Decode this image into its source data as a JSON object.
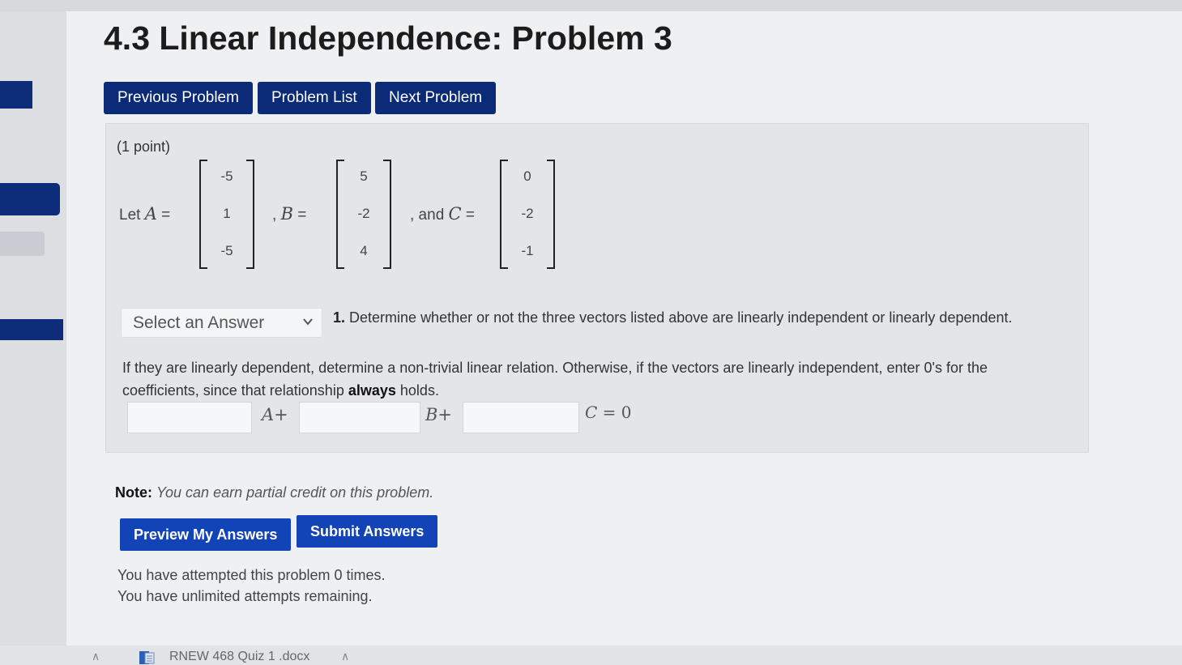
{
  "page": {
    "title": "4.3 Linear Independence: Problem 3"
  },
  "nav": {
    "previous_label": "Previous Problem",
    "list_label": "Problem List",
    "next_label": "Next Problem"
  },
  "problem": {
    "points": "(1 point)",
    "let_text": "Let",
    "and_text": ", and",
    "matrices": {
      "A": {
        "name": "A",
        "entries": [
          "-5",
          "1",
          "-5"
        ]
      },
      "B": {
        "name": "B",
        "entries": [
          "5",
          "-2",
          "4"
        ]
      },
      "C": {
        "name": "C",
        "entries": [
          "0",
          "-2",
          "-1"
        ]
      }
    }
  },
  "question1": {
    "select_value": "Select an Answer",
    "number": "1.",
    "text": "Determine whether or not the three vectors listed above are linearly independent or linearly dependent."
  },
  "relation": {
    "text_before": "If they are linearly dependent, determine a non-trivial linear relation. Otherwise, if the vectors are linearly independent, enter 0's for the coefficients, since that relationship",
    "emphasis": "always",
    "text_after": "holds.",
    "coef_a": "A+",
    "coef_b": "B+",
    "equation_var": "C",
    "equation_rest": " = 0",
    "inputs": {
      "a": "",
      "b": "",
      "c": ""
    }
  },
  "note": {
    "label": "Note:",
    "text": "You can earn partial credit on this problem."
  },
  "actions": {
    "preview_label": "Preview My Answers",
    "submit_label": "Submit Answers"
  },
  "status": {
    "attempts": "You have attempted this problem 0 times.",
    "remaining": "You have unlimited attempts remaining."
  },
  "taskbar": {
    "file_name": "RNEW 468 Quiz 1 .docx",
    "icons": [
      "chevron-up-icon",
      "word-doc-icon"
    ]
  },
  "colors": {
    "nav_button": "#0b2a78",
    "action_button": "#1244b8",
    "background": "#eff0f2"
  }
}
